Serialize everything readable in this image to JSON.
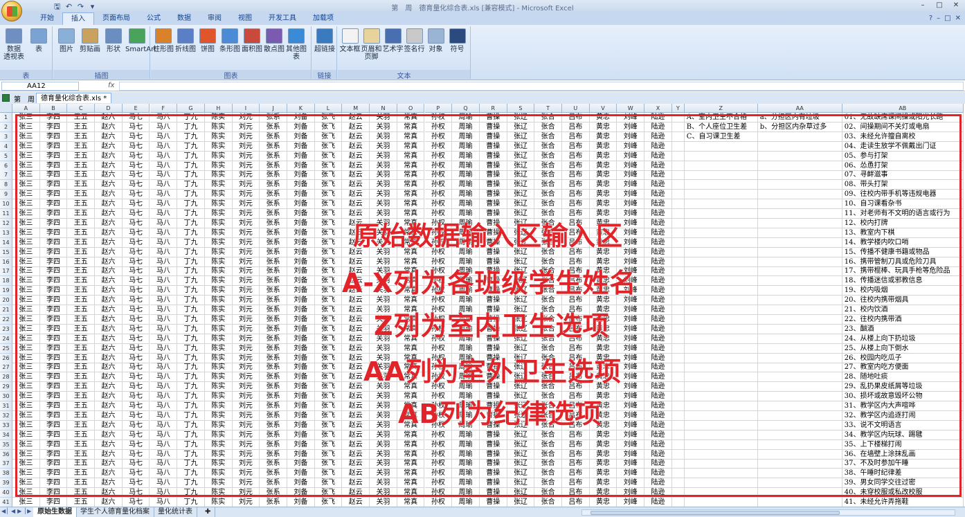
{
  "window": {
    "title": "第　周　德育量化综合表.xls  [兼容模式] - Microsoft Excel"
  },
  "qat": [
    "save-icon",
    "undo-icon",
    "redo-icon",
    "customize-icon"
  ],
  "tabs": [
    "开始",
    "插入",
    "页面布局",
    "公式",
    "数据",
    "审阅",
    "视图",
    "开发工具",
    "加载项"
  ],
  "active_tab": "插入",
  "ribbon": {
    "groups": [
      {
        "label": "表",
        "buttons": [
          "数据\n透视表",
          "表"
        ]
      },
      {
        "label": "插图",
        "buttons": [
          "图片",
          "剪贴画",
          "形状",
          "SmartArt"
        ]
      },
      {
        "label": "图表",
        "buttons": [
          "柱形图",
          "折线图",
          "饼图",
          "条形图",
          "面积图",
          "散点图",
          "其他图表"
        ]
      },
      {
        "label": "链接",
        "buttons": [
          "超链接"
        ]
      },
      {
        "label": "文本",
        "buttons": [
          "文本框",
          "页眉和\n页脚",
          "艺术字",
          "签名行",
          "对象",
          "符号"
        ]
      }
    ]
  },
  "formula_bar": {
    "name_box": "AA12",
    "fx": "fx",
    "content": ""
  },
  "document": {
    "sheet_group": "第　周",
    "file_name": "德育量化综合表.xls *"
  },
  "columns": [
    "A",
    "B",
    "C",
    "D",
    "E",
    "F",
    "G",
    "H",
    "I",
    "J",
    "K",
    "L",
    "M",
    "N",
    "O",
    "P",
    "Q",
    "R",
    "S",
    "T",
    "U",
    "V",
    "W",
    "X",
    "Y",
    "Z",
    "AA",
    "AB"
  ],
  "names": [
    "张三",
    "李四",
    "王五",
    "赵六",
    "马七",
    "马八",
    "丁九",
    "陈实",
    "刘元",
    "张系",
    "刘备",
    "张飞",
    "赵云",
    "关羽",
    "常真",
    "孙权",
    "周瑜",
    "曹操",
    "张辽",
    "张合",
    "吕布",
    "黄忠",
    "刘峰",
    "陆逊"
  ],
  "z_options": [
    "A、室内卫生不合格",
    "B、个人座位卫生差",
    "C、自习课卫生差"
  ],
  "aa_options": [
    "a、分担区内有垃圾",
    "b、分担区内杂草过多"
  ],
  "ab_options": [
    "01、无故缺席课间操或阳光长跑",
    "02、间操期间不关灯或电扇",
    "03、未经允许擅自离校",
    "04、走读生放学不佩戴出门证",
    "05、参与打架",
    "06、怂恿打架",
    "07、寻衅滋事",
    "08、带头打架",
    "09、往校内带手机等违规电器",
    "10、自习课看杂书",
    "11、对老师有不文明的语言或行为",
    "12、校内打牌",
    "13、教室内下棋",
    "14、教学楼内吹口哨",
    "15、传播不健康书籍或物品",
    "16、携带管制刀具或危险刀具",
    "17、携带棍棒、玩具手枪等危险品",
    "18、传播迷信或邪教信息",
    "19、校内吸烟",
    "20、往校内携带烟具",
    "21、校内饮酒",
    "22、往校内携带酒",
    "23、酗酒",
    "24、从楼上向下扔垃圾",
    "25、从楼上向下倒水",
    "26、校园内吃瓜子",
    "27、教室内吃方便面",
    "28、随地吐痰",
    "29、乱扔果皮纸屑等垃圾",
    "30、损坏或故意毁坏公物",
    "31、教学区内大声喧哗",
    "32、教学区内追逐打闹",
    "33、说不文明语言",
    "34、教学区内玩球、踢毽",
    "35、上下楼梯打闹",
    "36、在墙壁上涂抹乱画",
    "37、不及时参加午睡",
    "38、午睡时纪律差",
    "39、男女同学交往过密",
    "40、未穿校服或私改校服",
    "41、未经允许弄拖鞋"
  ],
  "overlay": [
    "原始数据输入区输入区",
    "A-X列为各班级学生姓名",
    "Z列为室内卫生选项",
    "AA列为室外卫生选项",
    "AB列为纪律选项"
  ],
  "sheet_tabs": [
    "原始生数据",
    "学生个人德育量化档案",
    "量化统计表"
  ],
  "active_sheet_tab": "原始生数据",
  "colors": {
    "annotation_red": "#e0242a",
    "ribbon_blue": "#d0e1f5",
    "tab_text": "#15428b"
  }
}
